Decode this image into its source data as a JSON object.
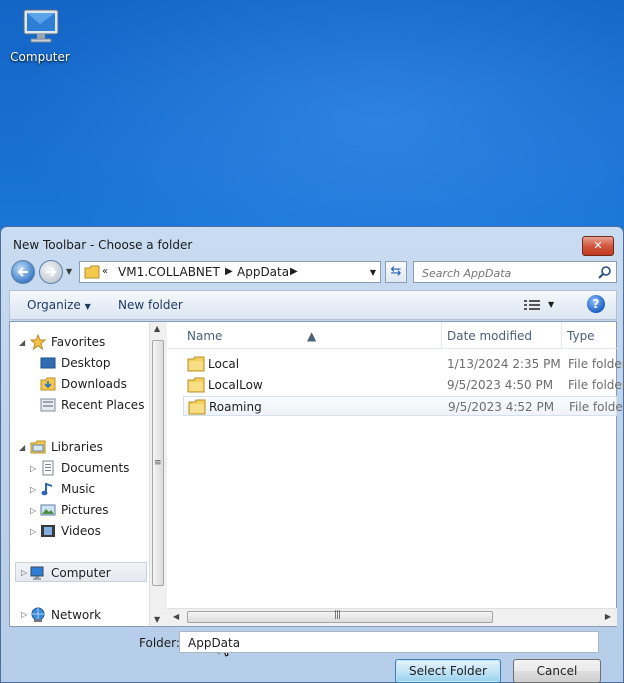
{
  "desktop": {
    "icons": [
      {
        "label": "Computer",
        "icon": "computer-icon"
      }
    ]
  },
  "dialog": {
    "title": "New Toolbar - Choose a folder",
    "close_label": "✕",
    "address": {
      "crumbs": [
        "VM1.COLLABNET",
        "AppData"
      ],
      "history_glyph": "«"
    },
    "search": {
      "placeholder": "Search AppData"
    },
    "toolbar": {
      "organize_label": "Organize",
      "new_folder_label": "New folder",
      "help_label": "?"
    },
    "nav": {
      "favorites": {
        "label": "Favorites",
        "items": [
          "Desktop",
          "Downloads",
          "Recent Places"
        ]
      },
      "libraries": {
        "label": "Libraries",
        "items": [
          "Documents",
          "Music",
          "Pictures",
          "Videos"
        ]
      },
      "computer_label": "Computer",
      "network_label": "Network"
    },
    "columns": {
      "name": "Name",
      "date": "Date modified",
      "type": "Type"
    },
    "files": [
      {
        "name": "Local",
        "date": "1/13/2024 2:35 PM",
        "type": "File folder"
      },
      {
        "name": "LocalLow",
        "date": "9/5/2023 4:50 PM",
        "type": "File folder"
      },
      {
        "name": "Roaming",
        "date": "9/5/2023 4:52 PM",
        "type": "File folder"
      }
    ],
    "folder_label": "Folder:",
    "folder_value": "AppData",
    "select_button": "Select Folder",
    "cancel_button": "Cancel"
  },
  "colors": {
    "desktop_blue": "#1a76d8",
    "dialog_frame": "#bdd3ec",
    "close_red": "#c0391e"
  }
}
